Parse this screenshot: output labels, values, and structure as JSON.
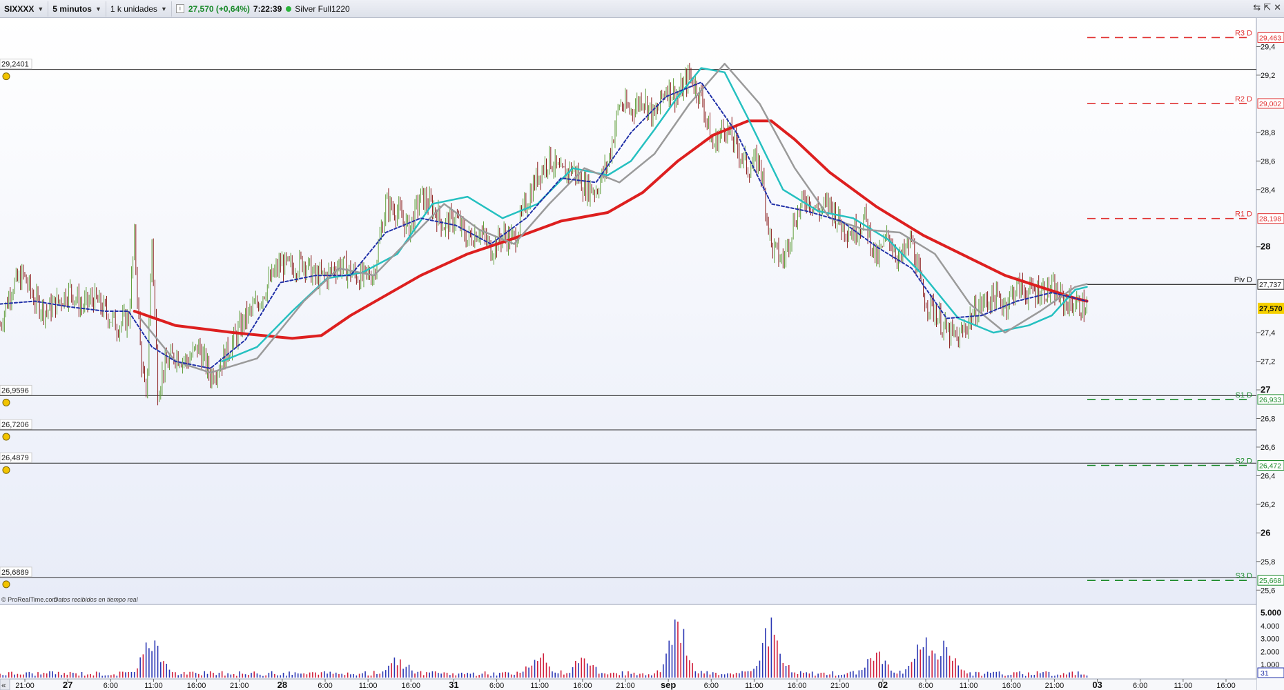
{
  "toolbar": {
    "symbol": "SIXXXX",
    "timeframe": "5 minutos",
    "units": "1 k unidades",
    "price": "27,570 (+0,64%)",
    "time": "7:22:39",
    "account": "Silver Full1220",
    "info_icon": "info-icon",
    "live_indicator": "green-dot-icon"
  },
  "footer": {
    "credit": "© ProRealTime.com",
    "credit_note": "Datos recibidos en tiempo real"
  },
  "chart_data": {
    "type": "line",
    "price_axis": {
      "range": [
        25.5,
        29.6
      ],
      "ticks": [
        "29,4",
        "29,2",
        "28,8",
        "28,6",
        "28,4",
        "28",
        "27,4",
        "27,2",
        "27",
        "26,8",
        "26,6",
        "26,4",
        "26,2",
        "26",
        "25,8",
        "25,6"
      ],
      "current_price": "27,570"
    },
    "time_axis": {
      "ticks": [
        "21:00",
        "27",
        "6:00",
        "11:00",
        "16:00",
        "21:00",
        "28",
        "6:00",
        "11:00",
        "16:00",
        "31",
        "6:00",
        "11:00",
        "16:00",
        "21:00",
        "sep",
        "6:00",
        "11:00",
        "16:00",
        "21:00",
        "02",
        "6:00",
        "11:00",
        "16:00",
        "21:00",
        "03",
        "6:00",
        "11:00",
        "16:00"
      ],
      "bold_ticks": [
        "27",
        "28",
        "31",
        "sep",
        "02",
        "03"
      ]
    },
    "horizontal_levels": [
      {
        "label": "29,2401",
        "value": 29.2401
      },
      {
        "label": "26,9596",
        "value": 26.9596
      },
      {
        "label": "26,7206",
        "value": 26.7206
      },
      {
        "label": "26,4879",
        "value": 26.4879
      },
      {
        "label": "25,6889",
        "value": 25.6889
      }
    ],
    "pivots": [
      {
        "name": "R3 D",
        "value": 29.463,
        "label": "29,463",
        "color": "#e03030"
      },
      {
        "name": "R2 D",
        "value": 29.002,
        "label": "29,002",
        "color": "#e03030"
      },
      {
        "name": "R1 D",
        "value": 28.198,
        "label": "28,198",
        "color": "#e03030"
      },
      {
        "name": "Piv D",
        "value": 27.737,
        "label": "27,737",
        "color": "#222222"
      },
      {
        "name": "S1 D",
        "value": 26.933,
        "label": "26,933",
        "color": "#1a8a2a"
      },
      {
        "name": "S2 D",
        "value": 26.472,
        "label": "26,472",
        "color": "#1a8a2a"
      },
      {
        "name": "S3 D",
        "value": 25.668,
        "label": "25,668",
        "color": "#1a8a2a"
      }
    ],
    "price_path": [
      {
        "t": 0,
        "p": 27.45
      },
      {
        "t": 2,
        "p": 27.72
      },
      {
        "t": 4,
        "p": 27.8
      },
      {
        "t": 6,
        "p": 27.62
      },
      {
        "t": 8,
        "p": 27.55
      },
      {
        "t": 10,
        "p": 27.62
      },
      {
        "t": 12,
        "p": 27.7
      },
      {
        "t": 14,
        "p": 27.58
      },
      {
        "t": 16,
        "p": 27.64
      },
      {
        "t": 18,
        "p": 27.55
      },
      {
        "t": 20,
        "p": 27.45
      },
      {
        "t": 22,
        "p": 27.5
      },
      {
        "t": 23,
        "p": 28.05
      },
      {
        "t": 24,
        "p": 27.3
      },
      {
        "t": 25,
        "p": 26.9
      },
      {
        "t": 26,
        "p": 28.05
      },
      {
        "t": 27,
        "p": 27.0
      },
      {
        "t": 28,
        "p": 27.15
      },
      {
        "t": 30,
        "p": 27.25
      },
      {
        "t": 32,
        "p": 27.2
      },
      {
        "t": 34,
        "p": 27.3
      },
      {
        "t": 36,
        "p": 27.1
      },
      {
        "t": 38,
        "p": 27.2
      },
      {
        "t": 40,
        "p": 27.35
      },
      {
        "t": 42,
        "p": 27.5
      },
      {
        "t": 44,
        "p": 27.6
      },
      {
        "t": 46,
        "p": 27.75
      },
      {
        "t": 48,
        "p": 27.88
      },
      {
        "t": 50,
        "p": 27.85
      },
      {
        "t": 52,
        "p": 27.9
      },
      {
        "t": 54,
        "p": 27.78
      },
      {
        "t": 56,
        "p": 27.8
      },
      {
        "t": 58,
        "p": 27.88
      },
      {
        "t": 60,
        "p": 27.82
      },
      {
        "t": 62,
        "p": 27.78
      },
      {
        "t": 64,
        "p": 27.82
      },
      {
        "t": 66,
        "p": 28.3
      },
      {
        "t": 68,
        "p": 28.25
      },
      {
        "t": 70,
        "p": 28.12
      },
      {
        "t": 72,
        "p": 28.35
      },
      {
        "t": 74,
        "p": 28.28
      },
      {
        "t": 76,
        "p": 28.15
      },
      {
        "t": 78,
        "p": 28.2
      },
      {
        "t": 80,
        "p": 28.05
      },
      {
        "t": 82,
        "p": 28.12
      },
      {
        "t": 84,
        "p": 27.98
      },
      {
        "t": 86,
        "p": 28.08
      },
      {
        "t": 88,
        "p": 28.05
      },
      {
        "t": 90,
        "p": 28.3
      },
      {
        "t": 92,
        "p": 28.5
      },
      {
        "t": 94,
        "p": 28.62
      },
      {
        "t": 96,
        "p": 28.5
      },
      {
        "t": 98,
        "p": 28.55
      },
      {
        "t": 100,
        "p": 28.42
      },
      {
        "t": 102,
        "p": 28.4
      },
      {
        "t": 104,
        "p": 28.58
      },
      {
        "t": 106,
        "p": 29.0
      },
      {
        "t": 108,
        "p": 28.95
      },
      {
        "t": 110,
        "p": 29.05
      },
      {
        "t": 112,
        "p": 28.9
      },
      {
        "t": 114,
        "p": 29.12
      },
      {
        "t": 116,
        "p": 29.05
      },
      {
        "t": 118,
        "p": 29.2
      },
      {
        "t": 120,
        "p": 29.05
      },
      {
        "t": 122,
        "p": 28.7
      },
      {
        "t": 124,
        "p": 28.85
      },
      {
        "t": 126,
        "p": 28.7
      },
      {
        "t": 128,
        "p": 28.55
      },
      {
        "t": 130,
        "p": 28.6
      },
      {
        "t": 132,
        "p": 28.0
      },
      {
        "t": 134,
        "p": 27.9
      },
      {
        "t": 136,
        "p": 28.2
      },
      {
        "t": 138,
        "p": 28.35
      },
      {
        "t": 140,
        "p": 28.25
      },
      {
        "t": 142,
        "p": 28.3
      },
      {
        "t": 144,
        "p": 28.15
      },
      {
        "t": 146,
        "p": 28.1
      },
      {
        "t": 148,
        "p": 28.2
      },
      {
        "t": 150,
        "p": 27.9
      },
      {
        "t": 152,
        "p": 28.08
      },
      {
        "t": 154,
        "p": 27.9
      },
      {
        "t": 156,
        "p": 28.05
      },
      {
        "t": 158,
        "p": 27.65
      },
      {
        "t": 160,
        "p": 27.55
      },
      {
        "t": 162,
        "p": 27.4
      },
      {
        "t": 164,
        "p": 27.35
      },
      {
        "t": 166,
        "p": 27.5
      },
      {
        "t": 168,
        "p": 27.6
      },
      {
        "t": 170,
        "p": 27.65
      },
      {
        "t": 172,
        "p": 27.6
      },
      {
        "t": 174,
        "p": 27.72
      },
      {
        "t": 176,
        "p": 27.68
      },
      {
        "t": 178,
        "p": 27.7
      },
      {
        "t": 180,
        "p": 27.7
      },
      {
        "t": 182,
        "p": 27.62
      },
      {
        "t": 184,
        "p": 27.6
      },
      {
        "t": 186,
        "p": 27.57
      }
    ],
    "series": [
      {
        "key": "sma_long",
        "color": "#dd1f1f",
        "width": 4,
        "dash": "",
        "points": [
          {
            "t": 23,
            "p": 27.55
          },
          {
            "t": 30,
            "p": 27.45
          },
          {
            "t": 40,
            "p": 27.4
          },
          {
            "t": 50,
            "p": 27.36
          },
          {
            "t": 55,
            "p": 27.38
          },
          {
            "t": 60,
            "p": 27.52
          },
          {
            "t": 66,
            "p": 27.66
          },
          {
            "t": 72,
            "p": 27.8
          },
          {
            "t": 80,
            "p": 27.95
          },
          {
            "t": 88,
            "p": 28.06
          },
          {
            "t": 96,
            "p": 28.18
          },
          {
            "t": 104,
            "p": 28.24
          },
          {
            "t": 110,
            "p": 28.38
          },
          {
            "t": 116,
            "p": 28.6
          },
          {
            "t": 122,
            "p": 28.78
          },
          {
            "t": 128,
            "p": 28.88
          },
          {
            "t": 132,
            "p": 28.88
          },
          {
            "t": 136,
            "p": 28.75
          },
          {
            "t": 142,
            "p": 28.52
          },
          {
            "t": 150,
            "p": 28.28
          },
          {
            "t": 158,
            "p": 28.08
          },
          {
            "t": 166,
            "p": 27.92
          },
          {
            "t": 172,
            "p": 27.8
          },
          {
            "t": 178,
            "p": 27.72
          },
          {
            "t": 184,
            "p": 27.64
          },
          {
            "t": 186,
            "p": 27.62
          }
        ]
      },
      {
        "key": "ma_teal",
        "color": "#25c0c0",
        "width": 2.5,
        "dash": "",
        "points": [
          {
            "t": 38,
            "p": 27.2
          },
          {
            "t": 44,
            "p": 27.3
          },
          {
            "t": 50,
            "p": 27.55
          },
          {
            "t": 56,
            "p": 27.78
          },
          {
            "t": 62,
            "p": 27.82
          },
          {
            "t": 68,
            "p": 27.95
          },
          {
            "t": 74,
            "p": 28.3
          },
          {
            "t": 80,
            "p": 28.35
          },
          {
            "t": 86,
            "p": 28.2
          },
          {
            "t": 92,
            "p": 28.3
          },
          {
            "t": 98,
            "p": 28.55
          },
          {
            "t": 104,
            "p": 28.5
          },
          {
            "t": 108,
            "p": 28.6
          },
          {
            "t": 112,
            "p": 28.82
          },
          {
            "t": 116,
            "p": 29.05
          },
          {
            "t": 120,
            "p": 29.25
          },
          {
            "t": 124,
            "p": 29.22
          },
          {
            "t": 128,
            "p": 28.9
          },
          {
            "t": 134,
            "p": 28.4
          },
          {
            "t": 140,
            "p": 28.25
          },
          {
            "t": 146,
            "p": 28.2
          },
          {
            "t": 152,
            "p": 28.05
          },
          {
            "t": 158,
            "p": 27.8
          },
          {
            "t": 164,
            "p": 27.5
          },
          {
            "t": 170,
            "p": 27.4
          },
          {
            "t": 176,
            "p": 27.45
          },
          {
            "t": 180,
            "p": 27.52
          },
          {
            "t": 184,
            "p": 27.7
          },
          {
            "t": 186,
            "p": 27.72
          }
        ]
      },
      {
        "key": "ma_grey",
        "color": "#9a9a9a",
        "width": 2.5,
        "dash": "",
        "points": [
          {
            "t": 24,
            "p": 27.5
          },
          {
            "t": 30,
            "p": 27.2
          },
          {
            "t": 36,
            "p": 27.12
          },
          {
            "t": 44,
            "p": 27.22
          },
          {
            "t": 52,
            "p": 27.62
          },
          {
            "t": 58,
            "p": 27.85
          },
          {
            "t": 64,
            "p": 27.8
          },
          {
            "t": 70,
            "p": 28.05
          },
          {
            "t": 76,
            "p": 28.3
          },
          {
            "t": 82,
            "p": 28.12
          },
          {
            "t": 88,
            "p": 28.02
          },
          {
            "t": 94,
            "p": 28.3
          },
          {
            "t": 100,
            "p": 28.55
          },
          {
            "t": 106,
            "p": 28.45
          },
          {
            "t": 112,
            "p": 28.65
          },
          {
            "t": 118,
            "p": 29.0
          },
          {
            "t": 124,
            "p": 29.28
          },
          {
            "t": 130,
            "p": 29.0
          },
          {
            "t": 136,
            "p": 28.55
          },
          {
            "t": 142,
            "p": 28.2
          },
          {
            "t": 148,
            "p": 28.12
          },
          {
            "t": 154,
            "p": 28.1
          },
          {
            "t": 160,
            "p": 27.95
          },
          {
            "t": 166,
            "p": 27.6
          },
          {
            "t": 172,
            "p": 27.4
          },
          {
            "t": 178,
            "p": 27.55
          },
          {
            "t": 184,
            "p": 27.72
          },
          {
            "t": 186,
            "p": 27.74
          }
        ]
      },
      {
        "key": "ma_dotted",
        "color": "#2030a8",
        "width": 2,
        "dash": "4 3",
        "points": [
          {
            "t": 0,
            "p": 27.6
          },
          {
            "t": 6,
            "p": 27.62
          },
          {
            "t": 12,
            "p": 27.58
          },
          {
            "t": 18,
            "p": 27.55
          },
          {
            "t": 22,
            "p": 27.55
          },
          {
            "t": 26,
            "p": 27.3
          },
          {
            "t": 30,
            "p": 27.2
          },
          {
            "t": 36,
            "p": 27.15
          },
          {
            "t": 42,
            "p": 27.35
          },
          {
            "t": 48,
            "p": 27.75
          },
          {
            "t": 54,
            "p": 27.8
          },
          {
            "t": 60,
            "p": 27.8
          },
          {
            "t": 66,
            "p": 28.1
          },
          {
            "t": 72,
            "p": 28.2
          },
          {
            "t": 78,
            "p": 28.15
          },
          {
            "t": 84,
            "p": 28.02
          },
          {
            "t": 90,
            "p": 28.2
          },
          {
            "t": 96,
            "p": 28.48
          },
          {
            "t": 102,
            "p": 28.45
          },
          {
            "t": 108,
            "p": 28.8
          },
          {
            "t": 114,
            "p": 29.05
          },
          {
            "t": 120,
            "p": 29.15
          },
          {
            "t": 126,
            "p": 28.8
          },
          {
            "t": 132,
            "p": 28.3
          },
          {
            "t": 138,
            "p": 28.25
          },
          {
            "t": 144,
            "p": 28.18
          },
          {
            "t": 150,
            "p": 28.0
          },
          {
            "t": 156,
            "p": 27.85
          },
          {
            "t": 162,
            "p": 27.5
          },
          {
            "t": 168,
            "p": 27.52
          },
          {
            "t": 174,
            "p": 27.62
          },
          {
            "t": 180,
            "p": 27.68
          },
          {
            "t": 186,
            "p": 27.62
          }
        ]
      }
    ],
    "volume_axis": {
      "ticks": [
        "5.000",
        "4.000",
        "3.000",
        "2.000",
        "1.000"
      ],
      "max": 5000,
      "current": "31"
    }
  }
}
